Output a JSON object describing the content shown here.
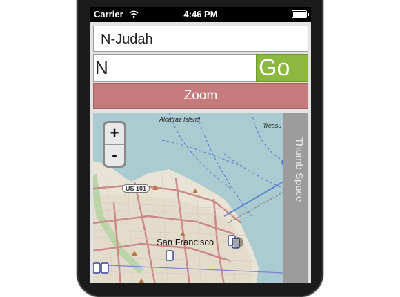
{
  "status_bar": {
    "carrier": "Carrier",
    "time": "4:46 PM"
  },
  "form": {
    "route_value": "N-Judah",
    "stop_value": "N",
    "go_label": "Go",
    "zoom_label": "Zoom"
  },
  "map": {
    "zoom_in": "+",
    "zoom_out": "-",
    "labels": {
      "alcatraz": "Alcatraz Island",
      "treasure": "Treasu",
      "us101": "US 101",
      "san_francisco": "San Francisco"
    }
  },
  "thumb_space": {
    "label": "Thumb Space"
  },
  "colors": {
    "go_green": "#8db840",
    "zoom_red": "#c57b7b",
    "thumb_gray": "#9c9c9c",
    "water": "#aacbd0"
  }
}
